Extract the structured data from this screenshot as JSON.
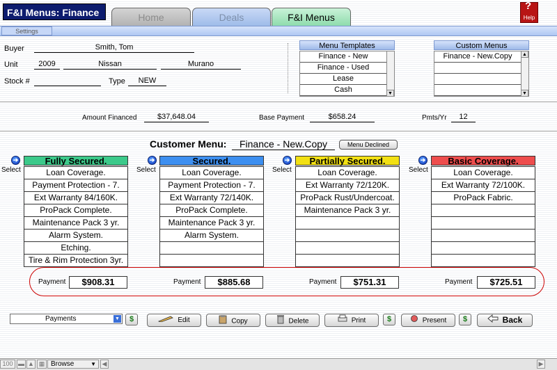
{
  "app": {
    "title": "F&I Menus: Finance",
    "help_label": "Help"
  },
  "tabs": [
    {
      "label": "Home"
    },
    {
      "label": "Deals"
    },
    {
      "label": "F&I Menus"
    }
  ],
  "subbar": {
    "settings_label": "Settings"
  },
  "deal": {
    "buyer_label": "Buyer",
    "buyer_value": "Smith, Tom",
    "unit_label": "Unit",
    "unit_year": "2009",
    "unit_make": "Nissan",
    "unit_model": "Murano",
    "stock_label": "Stock #",
    "stock_value": "",
    "type_label": "Type",
    "type_value": "NEW"
  },
  "menu_templates": {
    "header": "Menu Templates",
    "items": [
      "Finance - New",
      "Finance - Used",
      "Lease",
      "Cash"
    ]
  },
  "custom_menus": {
    "header": "Custom Menus",
    "items": [
      "Finance - New.Copy",
      "",
      "",
      ""
    ]
  },
  "financials": {
    "amount_financed_label": "Amount Financed",
    "amount_financed_value": "$37,648.04",
    "base_payment_label": "Base Payment",
    "base_payment_value": "$658.24",
    "pmts_label": "Pmts/Yr",
    "pmts_value": "12"
  },
  "customer_menu": {
    "label": "Customer Menu:",
    "value": "Finance - New.Copy",
    "declined_label": "Menu Declined"
  },
  "select_label": "Select",
  "columns": [
    {
      "title": "Fully Secured.",
      "color": "#3cc98a",
      "items": [
        "Loan Coverage.",
        "Payment Protection - 7.",
        "Ext Warranty 84/160K.",
        "ProPack Complete.",
        "Maintenance Pack 3 yr.",
        "Alarm System.",
        "Etching.",
        "Tire & Rim Protection 3yr."
      ],
      "payment_label": "Payment",
      "payment": "$908.31"
    },
    {
      "title": "Secured.",
      "color": "#3d8ff0",
      "items": [
        "Loan Coverage.",
        "Payment Protection - 7.",
        "Ext Warranty 72/140K.",
        "ProPack Complete.",
        "Maintenance Pack 3 yr.",
        "Alarm System.",
        "",
        ""
      ],
      "payment_label": "Payment",
      "payment": "$885.68"
    },
    {
      "title": "Partially Secured.",
      "color": "#f2e013",
      "items": [
        "Loan Coverage.",
        "Ext Warranty 72/120K.",
        "ProPack Rust/Undercoat.",
        "Maintenance Pack 3 yr.",
        "",
        "",
        "",
        ""
      ],
      "payment_label": "Payment",
      "payment": "$751.31"
    },
    {
      "title": "Basic Coverage.",
      "color": "#ee4d4d",
      "items": [
        "Loan Coverage.",
        "Ext Warranty 72/100K.",
        "ProPack Fabric.",
        "",
        "",
        "",
        "",
        ""
      ],
      "payment_label": "Payment",
      "payment": "$725.51"
    }
  ],
  "toolbar": {
    "payments_select": "Payments",
    "edit_label": "Edit",
    "copy_label": "Copy",
    "delete_label": "Delete",
    "print_label": "Print",
    "present_label": "Present",
    "back_label": "Back",
    "money_glyph": "$"
  },
  "statusbar": {
    "zoom": "100",
    "mode": "Browse"
  }
}
